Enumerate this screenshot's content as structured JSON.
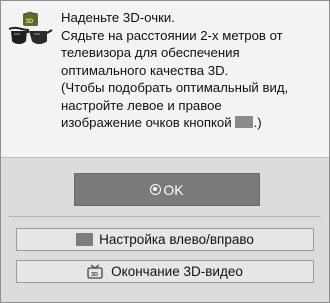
{
  "dialog": {
    "message_lines": [
      "Наденьте 3D-очки.",
      "Сядьте на расстоянии 2-х метров от",
      "телевизора для обеспечения",
      "оптимального качества 3D.",
      "(Чтобы подобрать оптимальный вид,",
      "настройте левое и правое"
    ],
    "last_line_before": "изображение очков кнопкой",
    "last_line_after": ".)",
    "glasses_icon": "3d-glasses-icon",
    "ok_label": "OK",
    "buttons": {
      "adjust_label": "Настройка влево/вправо",
      "end_label": "Окончание 3D-видео"
    },
    "colors": {
      "top_background": "#f3f3f3",
      "bottom_background": "#dcdcdc",
      "ok_button": "#7a7a7a",
      "swatch": "#8a8a8a"
    }
  }
}
